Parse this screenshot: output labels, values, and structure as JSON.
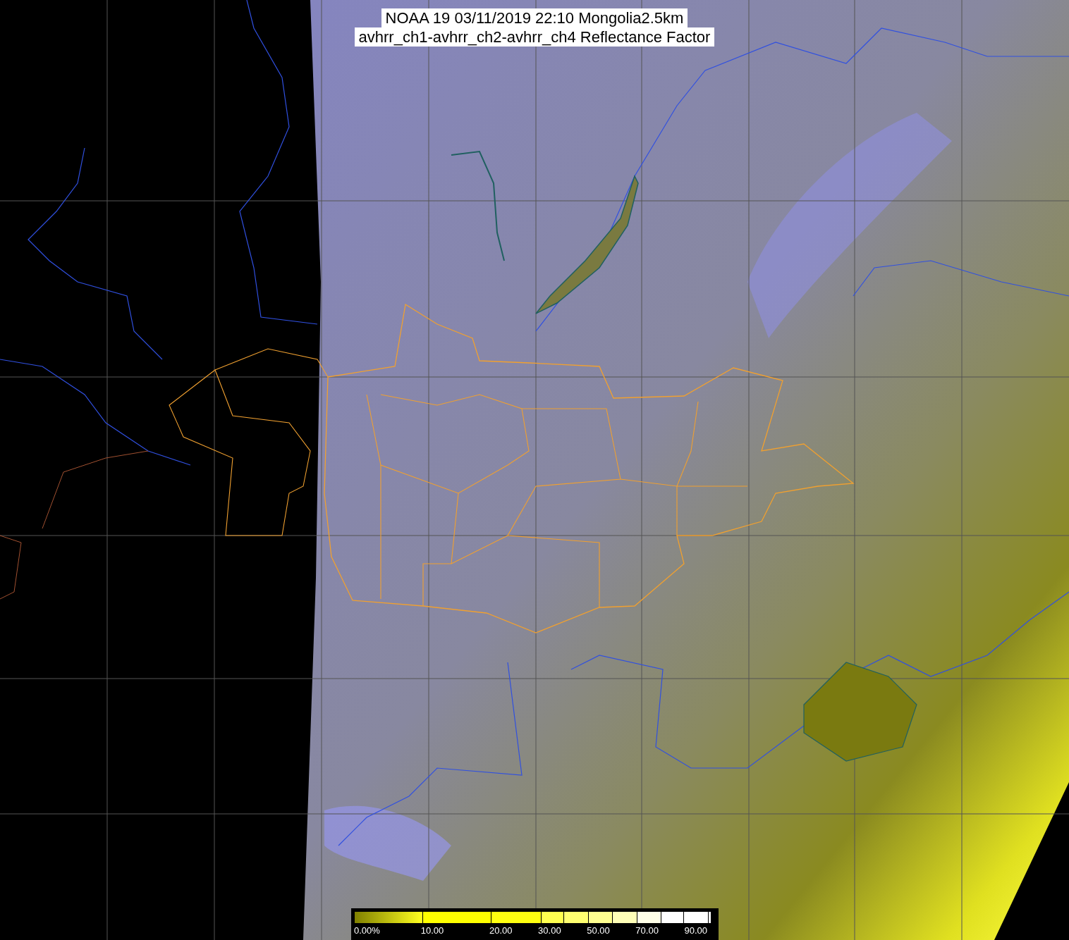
{
  "title": {
    "line_1": "NOAA 19 03/11/2019 22:10 Mongolia2.5km",
    "line_2": "avhrr_ch1-avhrr_ch2-avhrr_ch4 Reflectance Factor"
  },
  "colorbar": {
    "labels": [
      "0.00%",
      "10.00",
      "20.00",
      "30.00",
      "50.00",
      "70.00",
      "90.00"
    ]
  }
}
